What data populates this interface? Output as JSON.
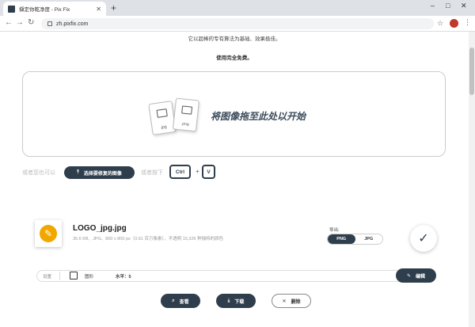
{
  "browser": {
    "tab_title": "擷定你乾净度 - Pix Fix",
    "url": "zh.pixfix.com"
  },
  "intro": {
    "line1": "它以超棒的专有算法为基础、效果极佳。",
    "line2": "使用完全免费。"
  },
  "dropzone": {
    "text": "将图像拖至此处以开始",
    "file_types": [
      ".jpg",
      ".png"
    ]
  },
  "upload": {
    "hint_left": "或者您也可以",
    "select_button": "选择要修复的图像",
    "hint_right": "或者按下",
    "key_ctrl": "Ctrl",
    "key_plus": "+",
    "key_v": "V"
  },
  "file": {
    "name": "LOGO_jpg.jpg",
    "meta": "35.6 KB、JPG、800 x 800 px（0.61 百万像素），不透明 15,326 种独特的颜色",
    "export_label": "导出:",
    "format_png": "PNG",
    "format_jpg": "JPG"
  },
  "settings": {
    "label": "设置",
    "shape_label": "图形",
    "level_label": "水平：5",
    "edit_button": "编辑"
  },
  "actions": {
    "view": "查看",
    "download": "下载",
    "delete": "删除"
  },
  "colors": {
    "accent": "#2f3e4c",
    "logo": "#f0a800"
  }
}
